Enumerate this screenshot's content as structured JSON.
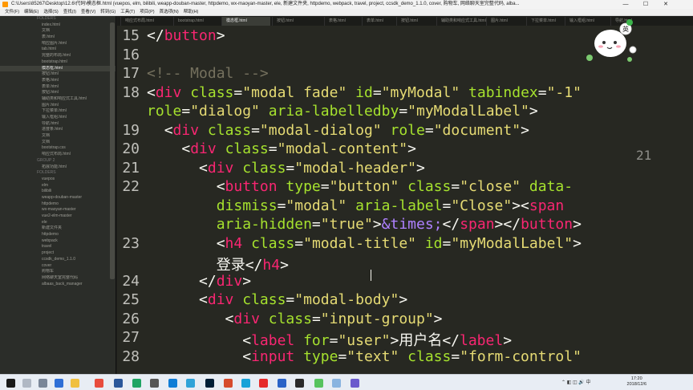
{
  "window": {
    "title": "C:\\Users\\85267\\Desktop\\12.6\\代码\\模态框.html (vuepos, elm, bilibili, weapp-douban-master, httpdemo, wx-maoyan-master, ele, 新建文件夹, httpdemo, webpack, travel, project, ccsdk_demo_1.1.0, cover, 购物车, 网络聊天室完整代码, alba..."
  },
  "menu": [
    "文件(F)",
    "编辑(E)",
    "选择(S)",
    "查找(I)",
    "查看(V)",
    "转到(G)",
    "工具(T)",
    "项目(P)",
    "首选项(N)",
    "帮助(H)"
  ],
  "sidebar": {
    "items": [
      {
        "label": "FOLDERS",
        "kind": "h"
      },
      {
        "label": "index.html",
        "kind": "f"
      },
      {
        "label": "文档",
        "kind": "f"
      },
      {
        "label": "表.html",
        "kind": "f"
      },
      {
        "label": "响应图片.html",
        "kind": "f"
      },
      {
        "label": "tab.html",
        "kind": "f"
      },
      {
        "label": "完整的布局.html",
        "kind": "f"
      },
      {
        "label": "bootstrap.html",
        "kind": "f"
      },
      {
        "label": "模态框.html",
        "kind": "f",
        "active": true
      },
      {
        "label": "按钮.html",
        "kind": "f"
      },
      {
        "label": "表格.html",
        "kind": "f"
      },
      {
        "label": "表单.html",
        "kind": "f"
      },
      {
        "label": "按钮.html",
        "kind": "f"
      },
      {
        "label": "辅助类和响应式工具.html",
        "kind": "f"
      },
      {
        "label": "图片.html",
        "kind": "f"
      },
      {
        "label": "下拉菜单.html",
        "kind": "f"
      },
      {
        "label": "输入框组.html",
        "kind": "f"
      },
      {
        "label": "导航.html",
        "kind": "f"
      },
      {
        "label": "进度条.html",
        "kind": "f"
      },
      {
        "label": "文档",
        "kind": "f"
      },
      {
        "label": "文档",
        "kind": "f"
      },
      {
        "label": "bootstrap.css",
        "kind": "f"
      },
      {
        "label": "响应式布局.html",
        "kind": "f"
      },
      {
        "label": "GROUP 2",
        "kind": "h"
      },
      {
        "label": "拓展功能.html",
        "kind": "f"
      },
      {
        "label": "FOLDERS",
        "kind": "h"
      },
      {
        "label": "vuepos",
        "kind": "f"
      },
      {
        "label": "elm",
        "kind": "f"
      },
      {
        "label": "bilibili",
        "kind": "f"
      },
      {
        "label": "weapp-douban-master",
        "kind": "f"
      },
      {
        "label": "httpdemo",
        "kind": "f"
      },
      {
        "label": "wx-maoyan-master",
        "kind": "f"
      },
      {
        "label": "vue2-elm-master",
        "kind": "f"
      },
      {
        "label": "ele",
        "kind": "f"
      },
      {
        "label": "新建文件夹",
        "kind": "f"
      },
      {
        "label": "httpdemo",
        "kind": "f"
      },
      {
        "label": "webpack",
        "kind": "f"
      },
      {
        "label": "travel",
        "kind": "f"
      },
      {
        "label": "project",
        "kind": "f"
      },
      {
        "label": "ccsdk_demo_1.1.0",
        "kind": "f"
      },
      {
        "label": "cover",
        "kind": "f"
      },
      {
        "label": "购物车",
        "kind": "f"
      },
      {
        "label": "网络聊天室完整代码",
        "kind": "f"
      },
      {
        "label": "albaas_back_manager",
        "kind": "f"
      }
    ]
  },
  "tabs": [
    {
      "label": "响应式布局.html"
    },
    {
      "label": "bootstrap.html"
    },
    {
      "label": "模态框.html",
      "active": true
    },
    {
      "label": "按钮.html"
    },
    {
      "label": "表格.html"
    },
    {
      "label": "表单.html"
    },
    {
      "label": "按钮.html"
    },
    {
      "label": "辅助类和响应式工具.html"
    },
    {
      "label": "图片.html"
    },
    {
      "label": "下拉菜单.html"
    },
    {
      "label": "输入框组.html"
    },
    {
      "label": "导航.html"
    }
  ],
  "code_lines": [
    {
      "n": "15",
      "html": "<span class=\"p\">&lt;/</span><span class=\"t\">button</span><span class=\"p\">&gt;</span>"
    },
    {
      "n": "16",
      "html": ""
    },
    {
      "n": "17",
      "html": "<span class=\"c\">&lt;!-- Modal --&gt;</span>"
    },
    {
      "n": "18",
      "html": "<span class=\"p\">&lt;</span><span class=\"t\">div</span> <span class=\"a\">class</span>=<span class=\"s\">\"modal fade\"</span> <span class=\"a\">id</span>=<span class=\"s\">\"myModal\"</span> <span class=\"a\">tabindex</span>=<span class=\"s\">\"-1\"</span>"
    },
    {
      "n": "",
      "html": "<span class=\"a\">role</span>=<span class=\"s\">\"dialog\"</span> <span class=\"a\">aria-labelledby</span>=<span class=\"s\">\"myModalLabel\"</span><span class=\"p\">&gt;</span>"
    },
    {
      "n": "19",
      "html": "  <span class=\"p\">&lt;</span><span class=\"t\">div</span> <span class=\"a\">class</span>=<span class=\"s\">\"modal-dialog\"</span> <span class=\"a\">role</span>=<span class=\"s\">\"document\"</span><span class=\"p\">&gt;</span>"
    },
    {
      "n": "20",
      "html": "    <span class=\"p\">&lt;</span><span class=\"t\">div</span> <span class=\"a\">class</span>=<span class=\"s\">\"modal-content\"</span><span class=\"p\">&gt;</span>"
    },
    {
      "n": "21",
      "html": "      <span class=\"p\">&lt;</span><span class=\"t\">div</span> <span class=\"a\">class</span>=<span class=\"s\">\"modal-header\"</span><span class=\"p\">&gt;</span>"
    },
    {
      "n": "22",
      "html": "        <span class=\"p\">&lt;</span><span class=\"t\">button</span> <span class=\"a\">type</span>=<span class=\"s\">\"button\"</span> <span class=\"a\">class</span>=<span class=\"s\">\"close\"</span> <span class=\"a\">data-</span>"
    },
    {
      "n": "",
      "html": "        <span class=\"a\">dismiss</span>=<span class=\"s\">\"modal\"</span> <span class=\"a\">aria-label</span>=<span class=\"s\">\"Close\"</span><span class=\"p\">&gt;&lt;</span><span class=\"t\">span</span>"
    },
    {
      "n": "",
      "html": "        <span class=\"a\">aria-hidden</span>=<span class=\"s\">\"true\"</span><span class=\"p\">&gt;</span><span class=\"e\">&amp;times;</span><span class=\"p\">&lt;/</span><span class=\"t\">span</span><span class=\"p\">&gt;&lt;/</span><span class=\"t\">button</span><span class=\"p\">&gt;</span>"
    },
    {
      "n": "23",
      "html": "        <span class=\"p\">&lt;</span><span class=\"t\">h4</span> <span class=\"a\">class</span>=<span class=\"s\">\"modal-title\"</span> <span class=\"a\">id</span>=<span class=\"s\">\"myModalLabel\"</span><span class=\"p\">&gt;</span>"
    },
    {
      "n": "",
      "html": "        <span class=\"p\">登录&lt;/</span><span class=\"t\">h4</span><span class=\"p\">&gt;</span>"
    },
    {
      "n": "24",
      "html": "      <span class=\"p\">&lt;/</span><span class=\"t\">div</span><span class=\"p\">&gt;</span>"
    },
    {
      "n": "25",
      "html": "      <span class=\"p\">&lt;</span><span class=\"t\">div</span> <span class=\"a\">class</span>=<span class=\"s\">\"modal-body\"</span><span class=\"p\">&gt;</span>"
    },
    {
      "n": "26",
      "html": "         <span class=\"p\">&lt;</span><span class=\"t\">div</span> <span class=\"a\">class</span>=<span class=\"s\">\"input-group\"</span><span class=\"p\">&gt;</span>"
    },
    {
      "n": "27",
      "html": "           <span class=\"p\">&lt;</span><span class=\"t\">label</span> <span class=\"a\">for</span>=<span class=\"s\">\"user\"</span><span class=\"p\">&gt;用户名&lt;/</span><span class=\"t\">label</span><span class=\"p\">&gt;</span>"
    },
    {
      "n": "28",
      "html": "           <span class=\"p\">&lt;</span><span class=\"t\">input</span> <span class=\"a\">type</span>=<span class=\"s\">\"text\"</span> <span class=\"a\">class</span>=<span class=\"s\">\"form-control\"</span>"
    }
  ],
  "minimap_line": "21",
  "clock": {
    "time": "17:20",
    "date": "2018/12/6"
  },
  "colors": {
    "accent": "#f92672",
    "attr": "#a6e22e",
    "string": "#e6db74",
    "comment": "#75715e",
    "bg": "#272822"
  }
}
